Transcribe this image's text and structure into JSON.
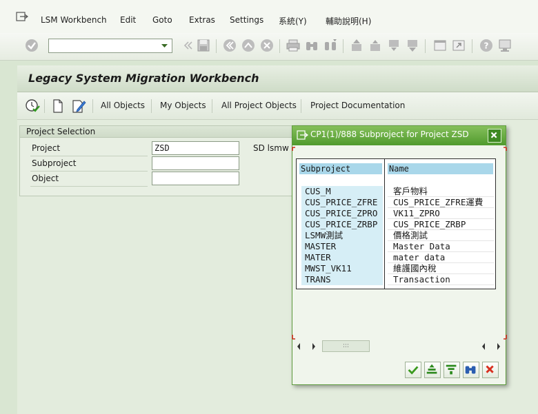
{
  "menu": {
    "items": [
      {
        "label": "LSM Workbench",
        "key": "L"
      },
      {
        "label": "Edit",
        "key": "E"
      },
      {
        "label": "Goto",
        "key": "G"
      },
      {
        "label": "Extras",
        "key": "x"
      },
      {
        "label": "Settings",
        "key": "S"
      },
      {
        "label": "系統(Y)",
        "key": ""
      },
      {
        "label": "輔助說明(H)",
        "key": ""
      }
    ]
  },
  "title": "Legacy System Migration Workbench",
  "app_toolbar": {
    "all_objects": "All Objects",
    "my_objects": "My Objects",
    "all_project_objects": "All Project Objects",
    "project_documentation": "Project Documentation"
  },
  "project_selection": {
    "title": "Project Selection",
    "project_label": "Project",
    "project_value": "ZSD",
    "project_desc": "SD lsmw",
    "subproject_label": "Subproject",
    "subproject_value": "",
    "object_label": "Object",
    "object_value": ""
  },
  "popup": {
    "title": "CP1(1)/888 Subproject for Project ZSD",
    "columns": [
      "Subproject",
      "Name"
    ],
    "rows": [
      {
        "subproject": "CUS_M",
        "name": "客戶物料"
      },
      {
        "subproject": "CUS_PRICE_ZFRE",
        "name": "CUS_PRICE_ZFRE運費"
      },
      {
        "subproject": "CUS_PRICE_ZPRO",
        "name": "VK11_ZPRO"
      },
      {
        "subproject": "CUS_PRICE_ZRBP",
        "name": "CUS_PRICE_ZRBP"
      },
      {
        "subproject": "LSMW測試",
        "name": "價格測試"
      },
      {
        "subproject": "MASTER",
        "name": "Master Data"
      },
      {
        "subproject": "MATER",
        "name": "mater data"
      },
      {
        "subproject": "MWST_VK11",
        "name": "維護國內稅"
      },
      {
        "subproject": "TRANS",
        "name": "Transaction"
      }
    ],
    "scroll_thumb": ":::"
  },
  "colors": {
    "accent_green": "#4f9a2d",
    "header_blue": "#a9d7ea",
    "cell_blue": "#d6eef6",
    "confirm_green": "#3a9a1e",
    "cancel_red": "#d83020"
  }
}
